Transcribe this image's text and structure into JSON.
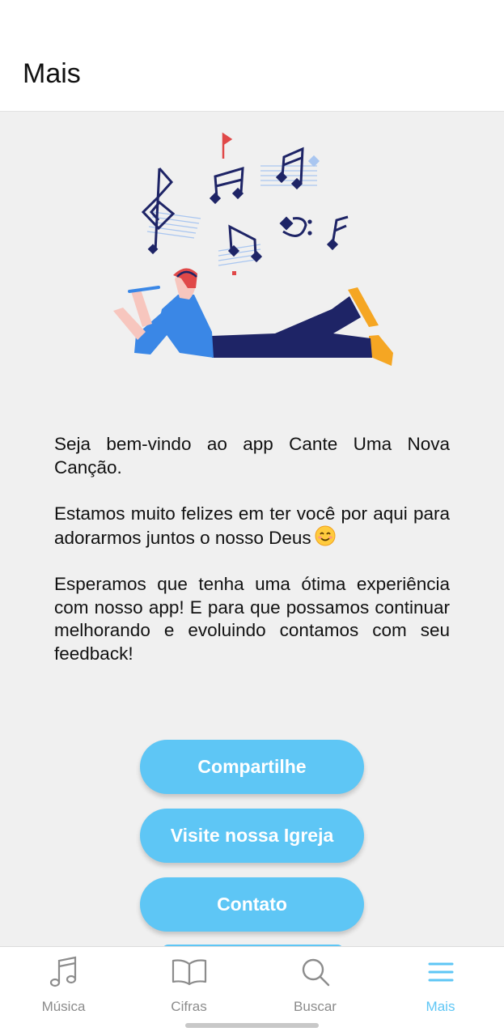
{
  "header": {
    "title": "Mais"
  },
  "welcome": {
    "paragraph1": "Seja bem-vindo ao app Cante Uma Nova Canção.",
    "paragraph2": "Estamos muito felizes em ter você por aqui para adorarmos juntos o nosso Deus",
    "paragraph3": "Esperamos que tenha uma ótima experiência com nosso app! E para que possamos continuar melhorando e evoluindo contamos com seu feedback!"
  },
  "buttons": {
    "share": "Compartilhe",
    "church": "Visite nossa Igreja",
    "contact": "Contato"
  },
  "tabs": [
    {
      "label": "Música",
      "icon": "music-note-icon"
    },
    {
      "label": "Cifras",
      "icon": "book-icon"
    },
    {
      "label": "Buscar",
      "icon": "search-icon"
    },
    {
      "label": "Mais",
      "icon": "menu-icon"
    }
  ],
  "colors": {
    "accent": "#5ec6f5",
    "tab_inactive": "#8c8c8c",
    "note_navy": "#1e2466",
    "shirt_blue": "#3a87e6",
    "shoe_orange": "#f5a623"
  }
}
